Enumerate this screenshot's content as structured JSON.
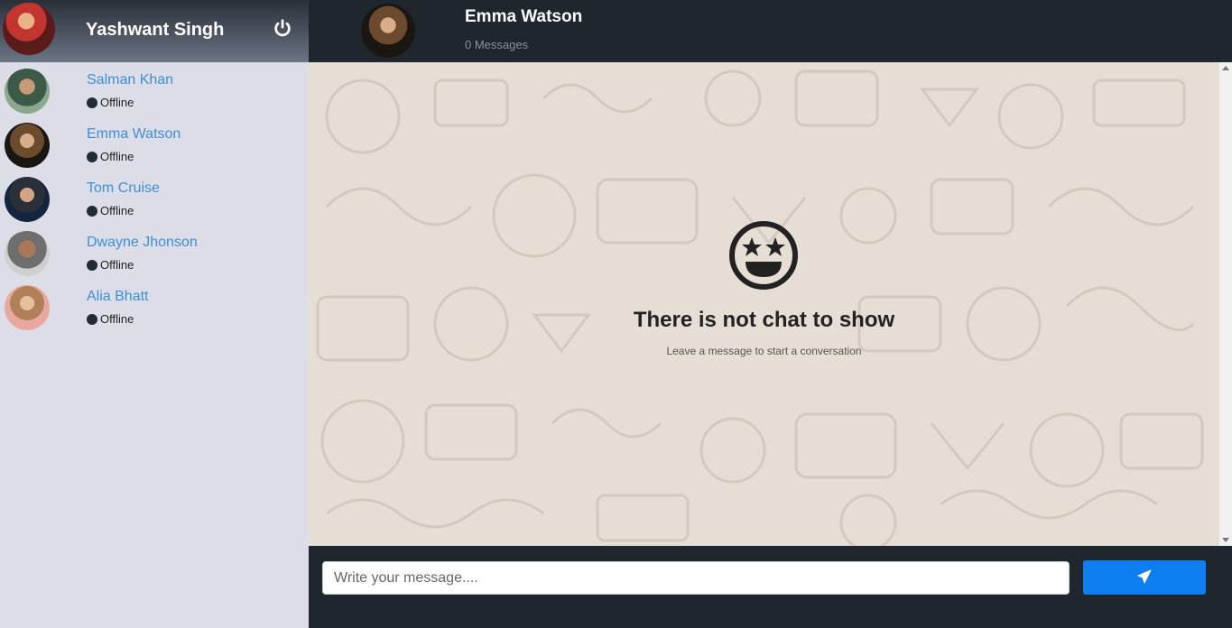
{
  "user": {
    "name": "Yashwant Singh"
  },
  "contacts": [
    {
      "name": "Salman Khan",
      "status": "Offline"
    },
    {
      "name": "Emma Watson",
      "status": "Offline"
    },
    {
      "name": "Tom Cruise",
      "status": "Offline"
    },
    {
      "name": "Dwayne Jhonson",
      "status": "Offline"
    },
    {
      "name": "Alia Bhatt",
      "status": "Offline"
    }
  ],
  "chat": {
    "name": "Emma Watson",
    "message_count": "0 Messages",
    "empty_title": "There is not chat to show",
    "empty_subtitle": "Leave a message to start a conversation"
  },
  "composer": {
    "placeholder": "Write your message...."
  },
  "icons": {
    "logout": "power-icon",
    "send": "paper-plane-icon",
    "empty": "star-struck-face-icon"
  },
  "colors": {
    "sidebar_bg": "#dcdde6",
    "header_bg": "#1f262e",
    "contact_name": "#3d8fd6",
    "send_button": "#0d7ef0",
    "chat_bg": "#e6ddd4"
  }
}
